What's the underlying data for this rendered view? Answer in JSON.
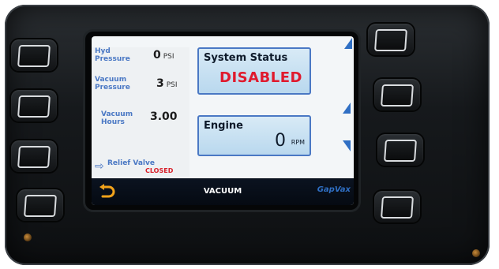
{
  "left_panel": {
    "hyd_pressure_label": "Hyd\nPressure",
    "hyd_pressure_value": "0",
    "hyd_pressure_unit": "PSI",
    "vacuum_pressure_label": "Vacuum\nPressure",
    "vacuum_pressure_value": "3",
    "vacuum_pressure_unit": "PSI",
    "vacuum_hours_label": "Vacuum\nHours",
    "vacuum_hours_value": "3.00",
    "relief_valve_label": "Relief Valve",
    "relief_valve_status": "CLOSED"
  },
  "system_status": {
    "title": "System Status",
    "value": "DISABLED"
  },
  "engine": {
    "title": "Engine",
    "value": "0",
    "unit": "RPM"
  },
  "bottom_bar": {
    "title": "VACUUM",
    "brand": "GapVax"
  },
  "colors": {
    "label_blue": "#4a78c4",
    "status_red": "#e01a2e",
    "accent_blue": "#2f6fc4",
    "bar_dark": "#050a12"
  },
  "icons": {
    "back": "back-arrow-icon",
    "relief": "arrow-right-icon",
    "nav_up": "triangle-up-icon",
    "nav_down": "triangle-down-icon"
  }
}
